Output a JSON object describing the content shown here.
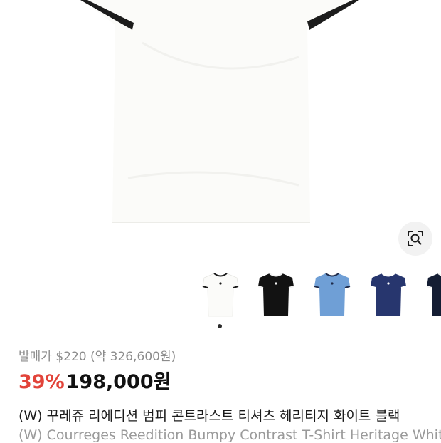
{
  "product": {
    "retail_price": "발매가 $220 (약 326,600원)",
    "discount": "39%",
    "price": "198,000원",
    "title_ko": "(W) 꾸레쥬 리에디션 범피 콘트라스트 티셔츠 헤리티지 화이트 블랙",
    "title_en": "(W) Courreges Reedition Bumpy Contrast T-Shirt Heritage White Black"
  },
  "gallery": {
    "lens_icon": "visual-search-icon",
    "active_index": 0,
    "thumbnails": [
      {
        "name": "thumbnail-white",
        "body": "#fbfbf9",
        "trim": "#1c1c1c"
      },
      {
        "name": "thumbnail-black",
        "body": "#121212",
        "trim": "#f2f2f2"
      },
      {
        "name": "thumbnail-light-blue",
        "body": "#6f9fd6",
        "trim": "#1f2b4a"
      },
      {
        "name": "thumbnail-navy",
        "body": "#27366e",
        "trim": "#ffffff"
      },
      {
        "name": "thumbnail-dark-navy",
        "body": "#141d33",
        "trim": "#f2f2f2"
      }
    ]
  },
  "colors": {
    "discount": "#e2443a",
    "price": "#111111",
    "muted": "#8b8b8b"
  }
}
